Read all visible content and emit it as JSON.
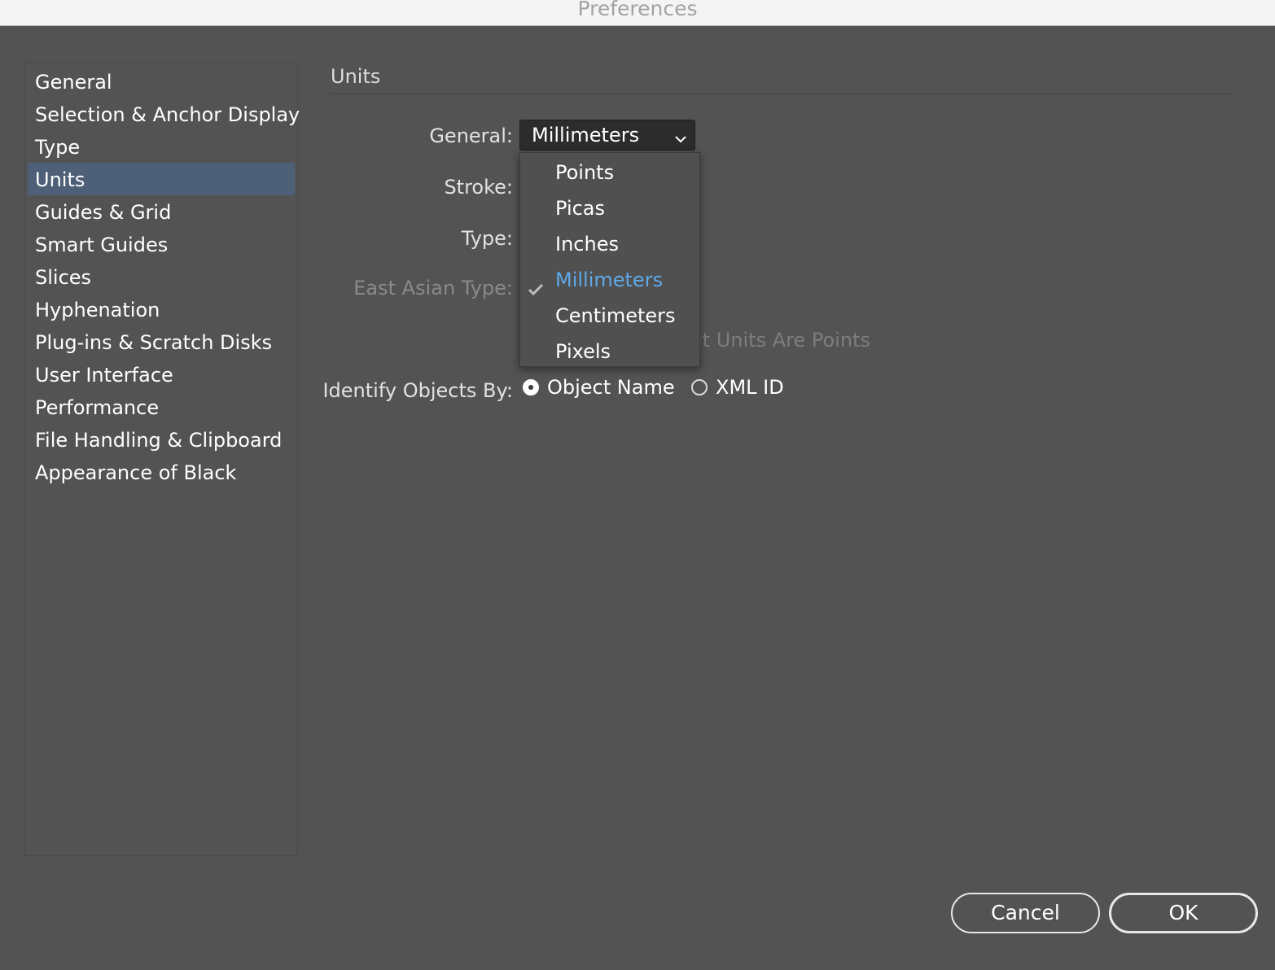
{
  "window": {
    "title": "Preferences"
  },
  "sidebar": {
    "items": [
      {
        "label": "General",
        "selected": false
      },
      {
        "label": "Selection & Anchor Display",
        "selected": false
      },
      {
        "label": "Type",
        "selected": false
      },
      {
        "label": "Units",
        "selected": true
      },
      {
        "label": "Guides & Grid",
        "selected": false
      },
      {
        "label": "Smart Guides",
        "selected": false
      },
      {
        "label": "Slices",
        "selected": false
      },
      {
        "label": "Hyphenation",
        "selected": false
      },
      {
        "label": "Plug-ins & Scratch Disks",
        "selected": false
      },
      {
        "label": "User Interface",
        "selected": false
      },
      {
        "label": "Performance",
        "selected": false
      },
      {
        "label": "File Handling & Clipboard",
        "selected": false
      },
      {
        "label": "Appearance of Black",
        "selected": false
      }
    ]
  },
  "main": {
    "section_title": "Units",
    "general_label": "General:",
    "general_value": "Millimeters",
    "stroke_label": "Stroke:",
    "type_label": "Type:",
    "east_asian_label": "East Asian Type:",
    "partial_checkbox_text": "ıt Units Are Points",
    "identify_label": "Identify Objects By:",
    "identify_options": [
      {
        "label": "Object Name",
        "checked": true
      },
      {
        "label": "XML ID",
        "checked": false
      }
    ]
  },
  "dropdown_menu": {
    "items": [
      {
        "label": "Points",
        "checked": false
      },
      {
        "label": "Picas",
        "checked": false
      },
      {
        "label": "Inches",
        "checked": false
      },
      {
        "label": "Millimeters",
        "checked": true
      },
      {
        "label": "Centimeters",
        "checked": false
      },
      {
        "label": "Pixels",
        "checked": false
      }
    ]
  },
  "buttons": {
    "cancel": "Cancel",
    "ok": "OK"
  },
  "colors": {
    "background": "#535353",
    "selected_row": "#4d6078",
    "checked_item": "#5fa8e8"
  },
  "icons": {
    "dropdown_arrow": "chevron-down-icon",
    "menu_check": "checkmark-icon"
  }
}
